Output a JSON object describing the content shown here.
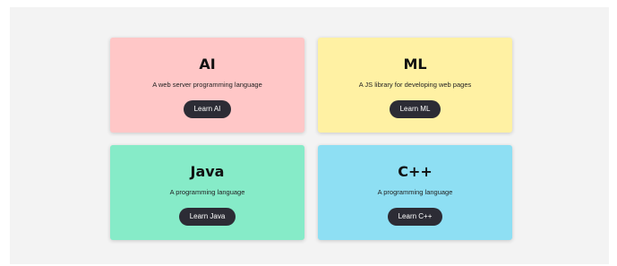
{
  "cards": [
    {
      "title": "AI",
      "description": "A web server programming language",
      "button_label": "Learn AI",
      "color": "#ffc7c7"
    },
    {
      "title": "ML",
      "description": "A JS library for developing web pages",
      "button_label": "Learn ML",
      "color": "#fff1a3"
    },
    {
      "title": "Java",
      "description": "A programming language",
      "button_label": "Learn Java",
      "color": "#86ebc8"
    },
    {
      "title": "C++",
      "description": "A programming language",
      "button_label": "Learn C++",
      "color": "#8edff3"
    }
  ],
  "colors": {
    "background": "#f3f3f3",
    "button": "#2c2c35",
    "button_text": "#ffffff"
  }
}
